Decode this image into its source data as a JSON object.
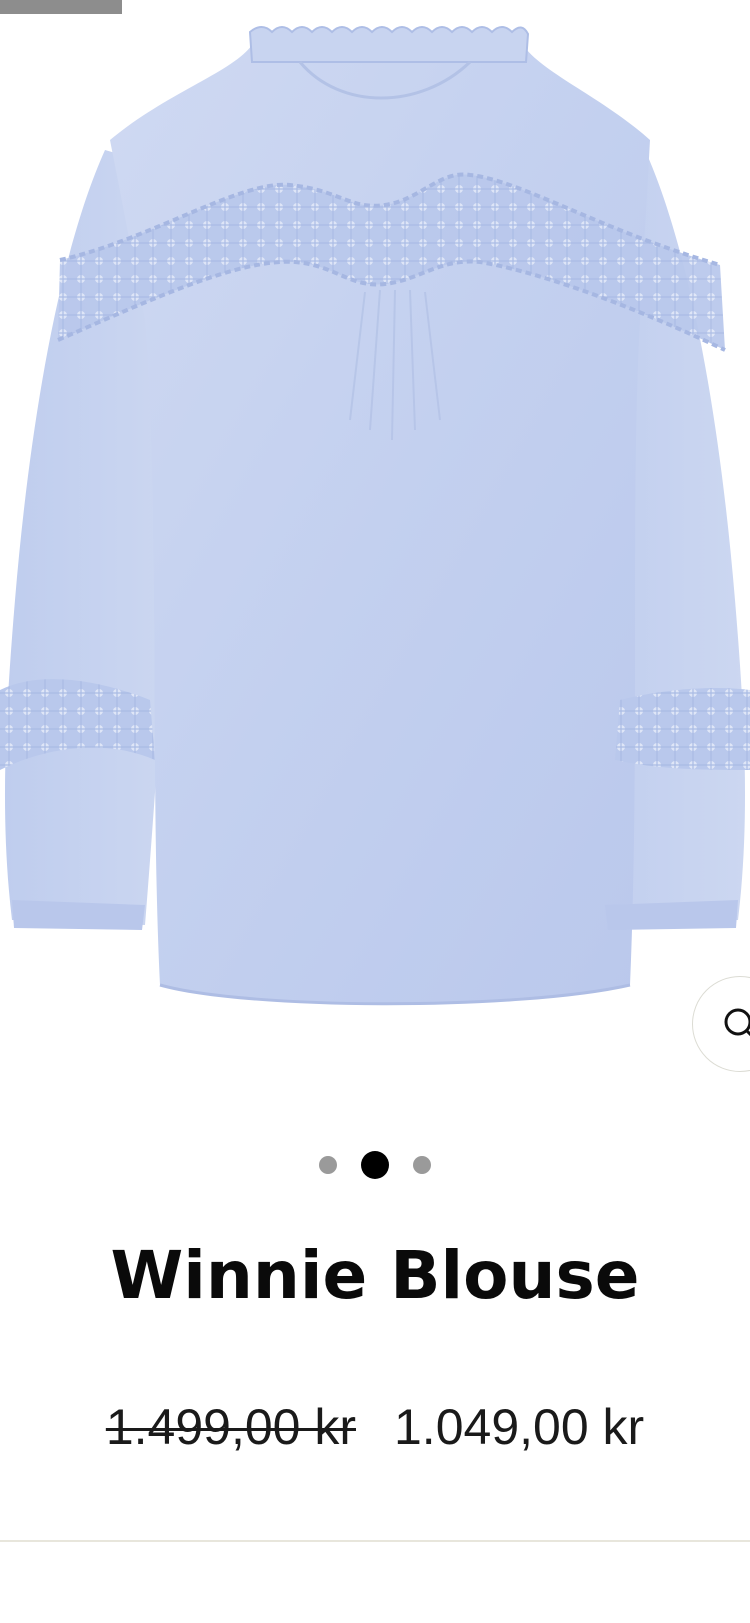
{
  "product": {
    "image_name": "light blue lace blouse back view",
    "title": "Winnie Blouse",
    "original_price": "1.499,00 kr",
    "sale_price": "1.049,00 kr"
  },
  "gallery": {
    "image_count": 3,
    "active_index": 1
  },
  "icons": {
    "zoom": "search-icon"
  },
  "colors": {
    "fabric": "#c6d3f0",
    "lace": "#b4c4ea",
    "active_dot": "#000000",
    "inactive_dot": "#9a9a9a"
  }
}
